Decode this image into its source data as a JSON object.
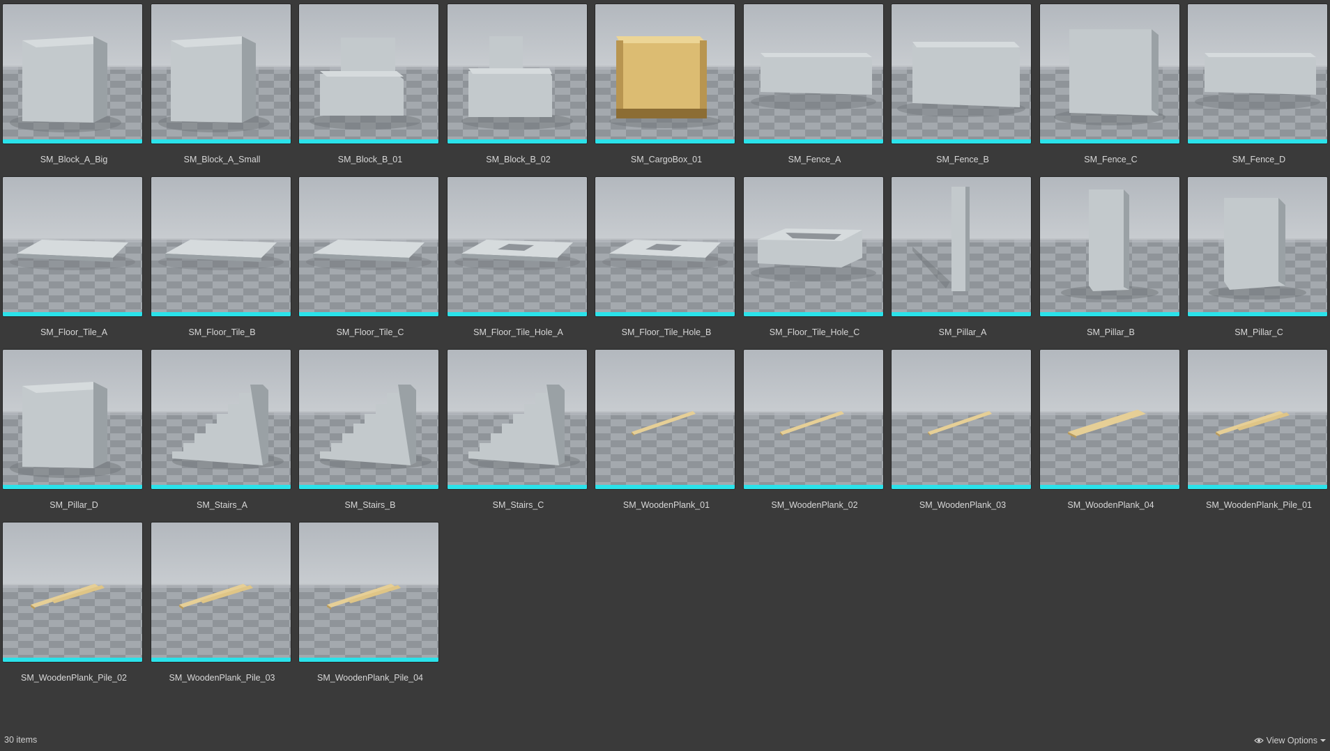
{
  "assets": [
    {
      "name": "SM_Block_A_Big",
      "kind": "cube"
    },
    {
      "name": "SM_Block_A_Small",
      "kind": "cube"
    },
    {
      "name": "SM_Block_B_01",
      "kind": "chair"
    },
    {
      "name": "SM_Block_B_02",
      "kind": "stack"
    },
    {
      "name": "SM_CargoBox_01",
      "kind": "crate"
    },
    {
      "name": "SM_Fence_A",
      "kind": "fence"
    },
    {
      "name": "SM_Fence_B",
      "kind": "fence_tall"
    },
    {
      "name": "SM_Fence_C",
      "kind": "wall"
    },
    {
      "name": "SM_Fence_D",
      "kind": "fence"
    },
    {
      "name": "SM_Floor_Tile_A",
      "kind": "tile"
    },
    {
      "name": "SM_Floor_Tile_B",
      "kind": "tile"
    },
    {
      "name": "SM_Floor_Tile_C",
      "kind": "tile"
    },
    {
      "name": "SM_Floor_Tile_Hole_A",
      "kind": "tile_hole"
    },
    {
      "name": "SM_Floor_Tile_Hole_B",
      "kind": "tile_hole"
    },
    {
      "name": "SM_Floor_Tile_Hole_C",
      "kind": "frame"
    },
    {
      "name": "SM_Pillar_A",
      "kind": "pillar_thin"
    },
    {
      "name": "SM_Pillar_B",
      "kind": "pillar"
    },
    {
      "name": "SM_Pillar_C",
      "kind": "pillar_wide"
    },
    {
      "name": "SM_Pillar_D",
      "kind": "cube"
    },
    {
      "name": "SM_Stairs_A",
      "kind": "stairs"
    },
    {
      "name": "SM_Stairs_B",
      "kind": "stairs"
    },
    {
      "name": "SM_Stairs_C",
      "kind": "stairs"
    },
    {
      "name": "SM_WoodenPlank_01",
      "kind": "plank"
    },
    {
      "name": "SM_WoodenPlank_02",
      "kind": "plank"
    },
    {
      "name": "SM_WoodenPlank_03",
      "kind": "plank"
    },
    {
      "name": "SM_WoodenPlank_04",
      "kind": "plank_wide"
    },
    {
      "name": "SM_WoodenPlank_Pile_01",
      "kind": "plank_pile"
    },
    {
      "name": "SM_WoodenPlank_Pile_02",
      "kind": "plank_pile"
    },
    {
      "name": "SM_WoodenPlank_Pile_03",
      "kind": "plank_pile"
    },
    {
      "name": "SM_WoodenPlank_Pile_04",
      "kind": "plank_pile"
    }
  ],
  "status": {
    "item_count": "30 items"
  },
  "view_options": {
    "label": "View Options",
    "icon": "eye-icon"
  },
  "colors": {
    "background": "#3a3a3a",
    "accent_bar": "#2be2ea",
    "concrete": "#c3c9cc",
    "wood": "#e6cf96"
  }
}
